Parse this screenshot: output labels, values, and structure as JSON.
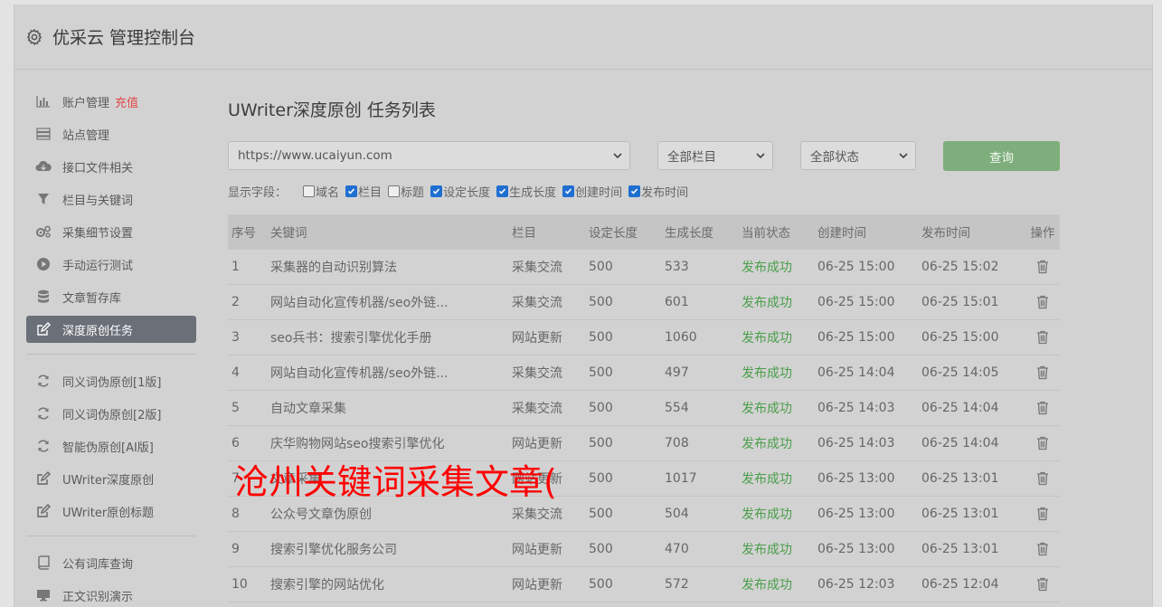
{
  "header": {
    "title": "优采云 管理控制台"
  },
  "sidebar": {
    "group1": [
      {
        "label": "账户管理",
        "extra": "充值",
        "icon": "bar-chart-icon"
      },
      {
        "label": "站点管理",
        "icon": "server-icon"
      },
      {
        "label": "接口文件相关",
        "icon": "cloud-download-icon"
      },
      {
        "label": "栏目与关键词",
        "icon": "filter-icon"
      },
      {
        "label": "采集细节设置",
        "icon": "cogs-icon"
      },
      {
        "label": "手动运行测试",
        "icon": "play-circle-icon"
      },
      {
        "label": "文章暂存库",
        "icon": "database-icon"
      },
      {
        "label": "深度原创任务",
        "icon": "edit-icon",
        "active": true
      }
    ],
    "group2": [
      {
        "label": "同义词伪原创[1版]",
        "icon": "refresh-icon"
      },
      {
        "label": "同义词伪原创[2版]",
        "icon": "refresh-icon"
      },
      {
        "label": "智能伪原创[AI版]",
        "icon": "refresh-icon"
      },
      {
        "label": "UWriter深度原创",
        "icon": "edit-icon"
      },
      {
        "label": "UWriter原创标题",
        "icon": "edit-icon"
      }
    ],
    "group3": [
      {
        "label": "公有词库查询",
        "icon": "book-icon"
      },
      {
        "label": "正文识别演示",
        "icon": "monitor-icon"
      }
    ]
  },
  "main": {
    "title": "UWriter深度原创 任务列表",
    "filters": {
      "site": "https://www.ucaiyun.com",
      "column": "全部栏目",
      "status": "全部状态",
      "query_label": "查询"
    },
    "fields_label": "显示字段：",
    "fields": [
      {
        "label": "域名",
        "checked": false
      },
      {
        "label": "栏目",
        "checked": true
      },
      {
        "label": "标题",
        "checked": false
      },
      {
        "label": "设定长度",
        "checked": true
      },
      {
        "label": "生成长度",
        "checked": true
      },
      {
        "label": "创建时间",
        "checked": true
      },
      {
        "label": "发布时间",
        "checked": true
      }
    ],
    "table": {
      "headers": [
        "序号",
        "关键词",
        "栏目",
        "设定长度",
        "生成长度",
        "当前状态",
        "创建时间",
        "发布时间",
        "操作"
      ],
      "rows": [
        [
          "1",
          "采集器的自动识别算法",
          "采集交流",
          "500",
          "533",
          "发布成功",
          "06-25 15:00",
          "06-25 15:02"
        ],
        [
          "2",
          "网站自动化宣传机器/seo外链...",
          "采集交流",
          "500",
          "601",
          "发布成功",
          "06-25 15:00",
          "06-25 15:01"
        ],
        [
          "3",
          "seo兵书：搜索引擎优化手册",
          "网站更新",
          "500",
          "1060",
          "发布成功",
          "06-25 15:00",
          "06-25 15:00"
        ],
        [
          "4",
          "网站自动化宣传机器/seo外链...",
          "采集交流",
          "500",
          "497",
          "发布成功",
          "06-25 14:04",
          "06-25 14:05"
        ],
        [
          "5",
          "自动文章采集",
          "采集交流",
          "500",
          "554",
          "发布成功",
          "06-25 14:03",
          "06-25 14:04"
        ],
        [
          "6",
          "庆华购物网站seo搜索引擎优化",
          "网站更新",
          "500",
          "708",
          "发布成功",
          "06-25 14:03",
          "06-25 14:04"
        ],
        [
          "7",
          "文章采集",
          "网站更新",
          "500",
          "1017",
          "发布成功",
          "06-25 13:00",
          "06-25 13:01"
        ],
        [
          "8",
          "公众号文章伪原创",
          "采集交流",
          "500",
          "504",
          "发布成功",
          "06-25 13:00",
          "06-25 13:01"
        ],
        [
          "9",
          "搜索引擎优化服务公司",
          "网站更新",
          "500",
          "470",
          "发布成功",
          "06-25 13:00",
          "06-25 13:01"
        ],
        [
          "10",
          "搜索引擎的网站优化",
          "网站更新",
          "500",
          "572",
          "发布成功",
          "06-25 12:03",
          "06-25 12:04"
        ]
      ]
    }
  },
  "watermark": "沧州关键词采集文章(",
  "colors": {
    "accent_active": "#6a6f78",
    "success": "#4a9e4a",
    "query_btn": "#7dae7b",
    "recharge": "#e34a4a",
    "watermark": "#ff0000"
  }
}
